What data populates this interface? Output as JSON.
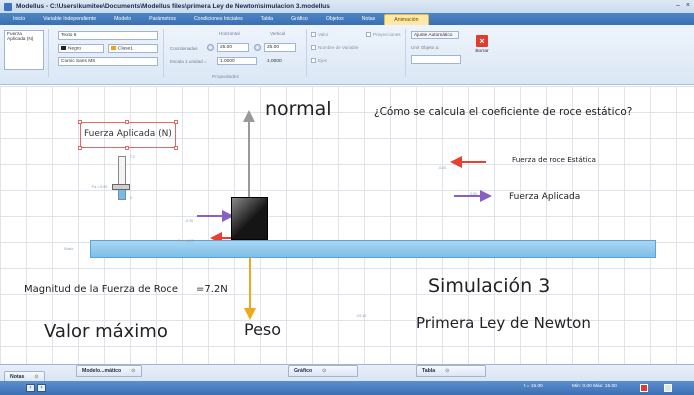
{
  "window": {
    "title": "Modellus - C:\\Users\\kumitee\\Documents\\Modellus files\\primera Ley de Newton\\simulacion 3.modellus",
    "controls": [
      "–",
      "×"
    ]
  },
  "ribbon_tabs": [
    {
      "label": "Inicio"
    },
    {
      "label": "Variable Independiente"
    },
    {
      "label": "Modelo"
    },
    {
      "label": "Parámetros"
    },
    {
      "label": "Condiciones Iniciales"
    },
    {
      "label": "Tabla"
    },
    {
      "label": "Gráfico"
    },
    {
      "label": "Objetos"
    },
    {
      "label": "Notas"
    },
    {
      "label": "Animación",
      "active": true
    }
  ],
  "ribbon": {
    "object_list_item": "Fuerza Aplicada (N)",
    "text_field": "Texto 6",
    "color_select": "Negro",
    "color_select_2": "Clase1",
    "font_select": "Comic Sans MS",
    "coords_label": "Coordenadas",
    "horizontal_label": "Horizontal",
    "vertical_label": "Vertical",
    "horizontal_value": "25.00",
    "vertical_value": "25.00",
    "scale_label": "Escala 1 unidad =",
    "scale_x": "1.0000",
    "scale_y": "1.0000",
    "chk_valor": "Valor",
    "chk_nombre": "Nombre de Variable",
    "chk_ejes": "Ejes",
    "chk_proyecciones": "Proyecciones",
    "ajuste_auto": "Ajuste Automático",
    "unir_objeto": "Unir Objeto a:",
    "borrar_label": "Borrar",
    "properties_label": "Propiedades"
  },
  "canvas": {
    "normal_label": "normal",
    "question": "¿Cómo se calcula el coeficiente de roce estático?",
    "legend_roce": "Fuerza de roce Estática",
    "legend_aplicada": "Fuerza Aplicada",
    "force_box_label": "Fuerza Aplicada (N)",
    "magnitud_text": "Magnitud de la Fuerza de Roce",
    "magnitud_value": "=7.2N",
    "valor_maximo": "Valor máximo",
    "peso_label": "Peso",
    "simulacion_title": "Simulación 3",
    "ley_title": "Primera Ley de Newton",
    "slider_max": "7.2",
    "slider_value": "Fa = 6.99",
    "slider_min": "0",
    "arrow_label_1": "-0.00",
    "arrow_label_2": "0.00",
    "arrow_label_3": "-0.20",
    "arrow_label_4": "-0.00",
    "ground_label": "Suelo",
    "peso_value": "-29.40",
    "roce_value": "Fr = -6.99",
    "slider_fill_fraction": 0.35,
    "colors": {
      "roce_arrow": "#e8402e",
      "aplicada_arrow": "#8a5fc4",
      "peso_arrow": "#f2a81d",
      "normal_arrow": "#9a9a9a",
      "ground": "#8fcaf0"
    }
  },
  "bottom_panels": [
    {
      "label": "Notas"
    },
    {
      "label": "Modelo...mático"
    },
    {
      "label": "Gráfico"
    },
    {
      "label": "Tabla"
    }
  ],
  "statusbar": {
    "t_readout": "t = 15.00",
    "range_readout": "Min: 0.00  Máx: 15.00"
  }
}
